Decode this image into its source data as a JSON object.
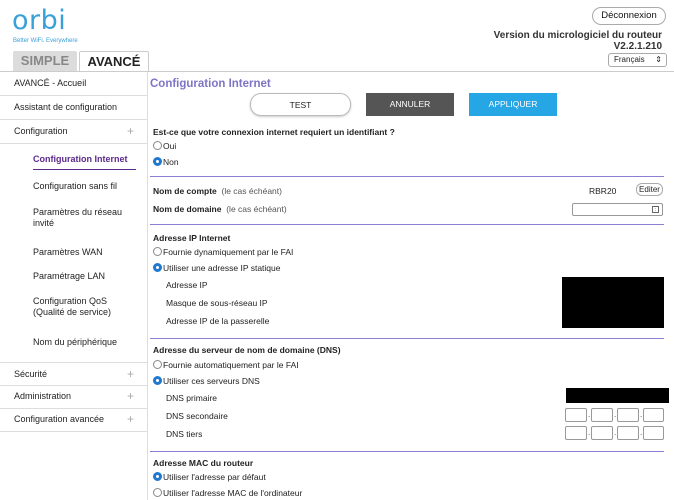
{
  "header": {
    "logo": "orbi",
    "tagline": "Better WiFi. Everywhere",
    "logout_label": "Déconnexion",
    "firmware_label": "Version du micrologiciel du routeur",
    "firmware_version": "V2.2.1.210",
    "language": "Français"
  },
  "tabs": {
    "simple": "SIMPLE",
    "advanced": "AVANCÉ"
  },
  "sidebar": {
    "home": "AVANCÉ - Accueil",
    "wizard": "Assistant de configuration",
    "config": "Configuration",
    "sub": {
      "internet": "Configuration Internet",
      "wireless": "Configuration sans fil",
      "guest1": "Paramètres du réseau",
      "guest2": "invité",
      "wan": "Paramètres WAN",
      "lan": "Paramétrage LAN",
      "qos1": "Configuration QoS",
      "qos2": "(Qualité de service)",
      "device": "Nom du périphérique"
    },
    "security": "Sécurité",
    "admin": "Administration",
    "advanced": "Configuration avancée"
  },
  "main": {
    "title": "Configuration Internet",
    "buttons": {
      "test": "TEST",
      "cancel": "ANNULER",
      "apply": "APPLIQUER"
    },
    "login_question": "Est-ce que votre connexion internet requiert un identifiant ?",
    "login_yes": "Oui",
    "login_no": "Non",
    "account_name": "Nom de compte",
    "account_hint": "(le cas échéant)",
    "account_value": "RBR20",
    "edit_label": "Editer",
    "domain_name": "Nom de domaine",
    "domain_hint": "(le cas échéant)",
    "ip_section": "Adresse IP Internet",
    "ip_dynamic": "Fournie dynamiquement par le FAI",
    "ip_static": "Utiliser une adresse IP statique",
    "ip_address": "Adresse IP",
    "subnet_mask": "Masque de sous-réseau IP",
    "gateway": "Adresse IP de la passerelle",
    "dns_section": "Adresse du serveur de nom de domaine (DNS)",
    "dns_auto": "Fournie automatiquement par le FAI",
    "dns_use": "Utiliser ces serveurs DNS",
    "dns_primary": "DNS primaire",
    "dns_secondary": "DNS secondaire",
    "dns_tertiary": "DNS tiers",
    "mac_section": "Adresse MAC du routeur",
    "mac_default": "Utiliser l'adresse par défaut",
    "mac_computer": "Utiliser l'adresse MAC de l'ordinateur"
  }
}
